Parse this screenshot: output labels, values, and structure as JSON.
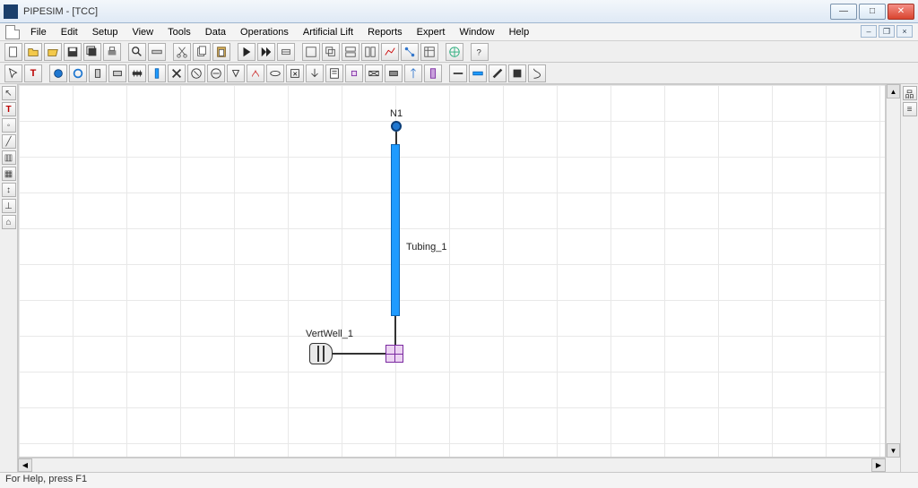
{
  "window": {
    "title": "PIPESIM - [TCC]"
  },
  "menu": {
    "file": "File",
    "edit": "Edit",
    "setup": "Setup",
    "view": "View",
    "tools": "Tools",
    "data": "Data",
    "operations": "Operations",
    "artificial_lift": "Artificial Lift",
    "reports": "Reports",
    "expert": "Expert",
    "window": "Window",
    "help": "Help"
  },
  "diagram": {
    "n1_label": "N1",
    "tubing_label": "Tubing_1",
    "vertwell_label": "VertWell_1"
  },
  "status": {
    "help_text": "For Help, press F1"
  },
  "icons": {
    "win_min": "—",
    "win_max": "□",
    "win_close": "✕",
    "mdi_min": "–",
    "mdi_restore": "❐",
    "mdi_close": "×"
  }
}
